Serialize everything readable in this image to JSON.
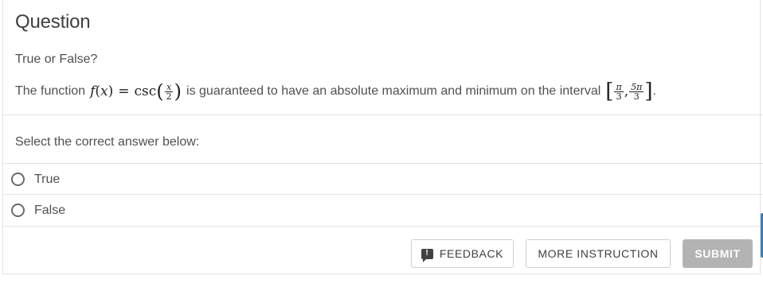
{
  "question": {
    "title": "Question",
    "type_label": "True or False?",
    "stem_prefix": "The function",
    "stem_function_name": "f",
    "stem_variable": "x",
    "stem_equals": "=",
    "stem_csc": "csc",
    "stem_frac_num": "x",
    "stem_frac_den": "2",
    "stem_middle": "is guaranteed to have an absolute maximum and minimum on the interval",
    "interval_left_num": "π",
    "interval_left_den": "3",
    "interval_right_num": "5π",
    "interval_right_den": "3",
    "stem_suffix": "."
  },
  "answer": {
    "prompt": "Select the correct answer below:",
    "options": [
      {
        "label": "True",
        "selected": false
      },
      {
        "label": "False",
        "selected": false
      }
    ]
  },
  "actions": {
    "feedback_label": "FEEDBACK",
    "feedback_icon": "exclamation-speech-bubble-icon",
    "more_instruction_label": "MORE INSTRUCTION",
    "submit_label": "SUBMIT",
    "submit_color": "#b3b3b3"
  },
  "colors": {
    "text": "#505050",
    "divider": "#e2e2e2",
    "edge_accent": "#2a82c8"
  }
}
